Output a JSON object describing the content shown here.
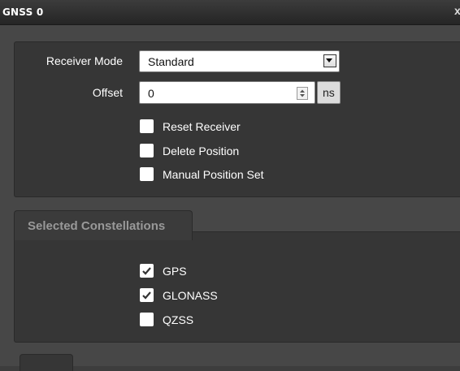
{
  "window": {
    "title": "GNSS 0",
    "close_glyph": "x"
  },
  "receiver": {
    "mode_label": "Receiver Mode",
    "mode_value": "Standard",
    "offset_label": "Offset",
    "offset_value": "0",
    "offset_unit": "ns",
    "options": [
      {
        "label": "Reset Receiver",
        "checked": false
      },
      {
        "label": "Delete Position",
        "checked": false
      },
      {
        "label": "Manual Position Set",
        "checked": false
      }
    ]
  },
  "constellations": {
    "tab_label": "Selected Constellations",
    "items": [
      {
        "label": "GPS",
        "checked": true
      },
      {
        "label": "GLONASS",
        "checked": true
      },
      {
        "label": "QZSS",
        "checked": false
      }
    ]
  },
  "colors": {
    "background": "#474747",
    "panel": "#363636",
    "checkmark": "#333333"
  }
}
